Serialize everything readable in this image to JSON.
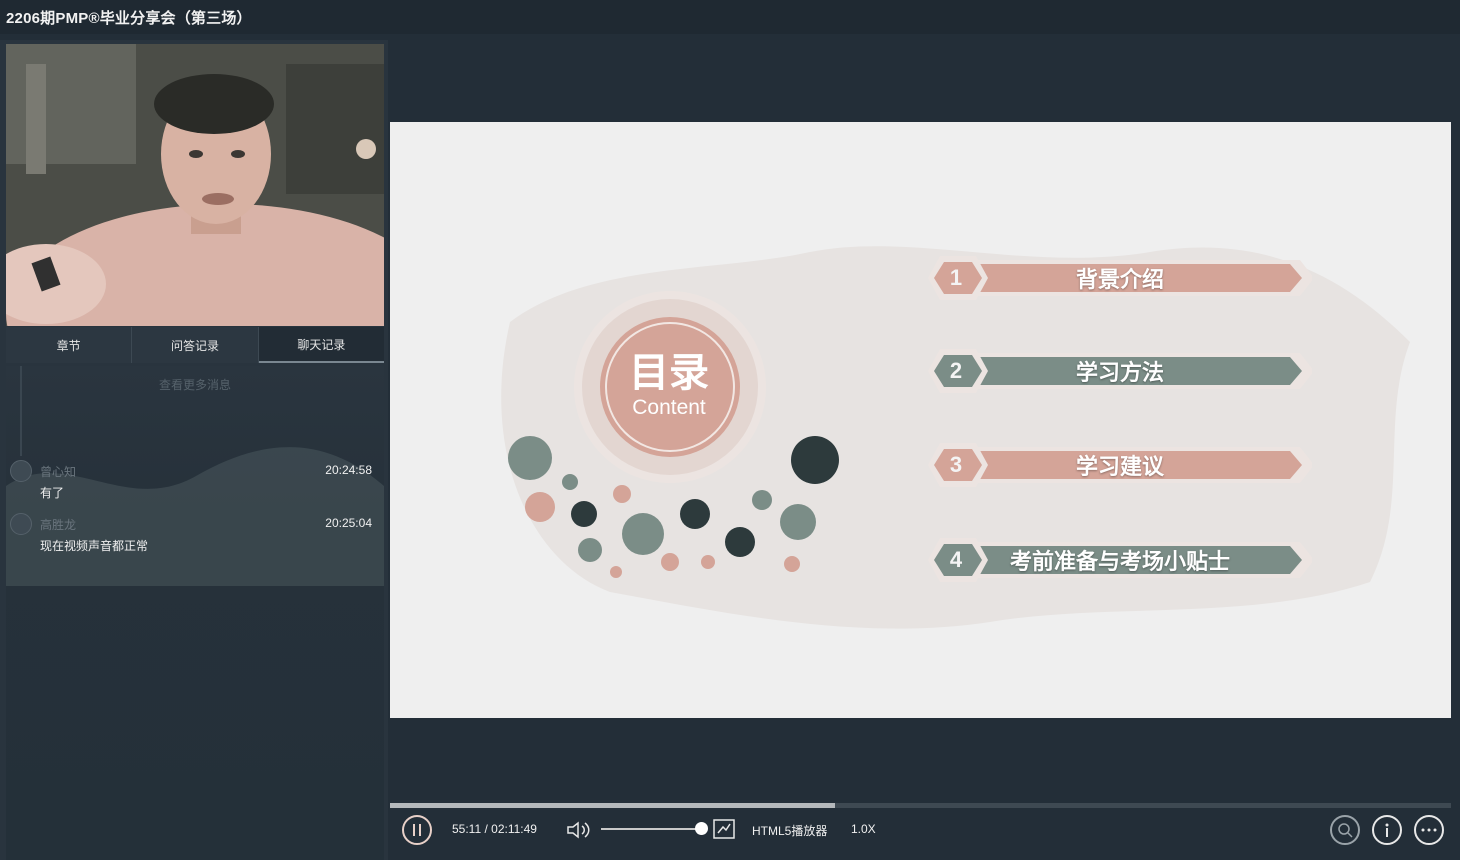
{
  "window": {
    "title": "2206期PMP®毕业分享会（第三场）"
  },
  "tabs": [
    "章节",
    "问答记录",
    "聊天记录"
  ],
  "active_tab": "聊天记录",
  "chat": {
    "more_label": "查看更多消息",
    "messages": [
      {
        "name": "曾心知",
        "time": "20:24:58",
        "text": "有了"
      },
      {
        "name": "高胜龙",
        "time": "20:25:04",
        "text": "现在视频声音都正常"
      }
    ]
  },
  "slide": {
    "title": "目录",
    "subtitle": "Content",
    "items": [
      {
        "num": "1",
        "label": "背景介绍",
        "color": "#d4a498"
      },
      {
        "num": "2",
        "label": "学习方法",
        "color": "#7b8d87"
      },
      {
        "num": "3",
        "label": "学习建议",
        "color": "#d4a498"
      },
      {
        "num": "4",
        "label": "考前准备与考场小贴士",
        "color": "#7b8d87"
      }
    ]
  },
  "player": {
    "time": "55:11 / 02:11:49",
    "progress": 0.419,
    "volume": 0.95,
    "engine": "HTML5播放器",
    "speed": "1.0X",
    "icons": [
      "pause-icon",
      "volume-icon",
      "picture-in-picture-icon",
      "search-user-icon",
      "info-icon",
      "more-icon"
    ]
  },
  "colors": {
    "accent_rose": "#d4a498",
    "accent_sage": "#7b8d87",
    "dark_teal": "#2d3a3c",
    "bg": "#232e38"
  }
}
